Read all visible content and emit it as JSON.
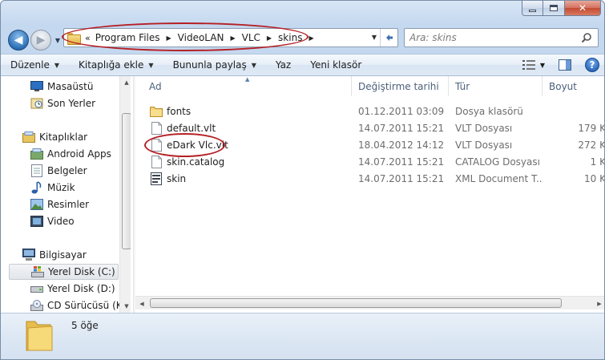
{
  "window": {
    "minimize_icon": "minimize-icon",
    "maximize_icon": "maximize-icon",
    "close_icon": "close-icon"
  },
  "address": {
    "overflow": "«",
    "crumbs": [
      "Program Files",
      "VideoLAN",
      "VLC",
      "skins"
    ]
  },
  "search": {
    "placeholder": "Ara: skins"
  },
  "toolbar": {
    "organize": "Düzenle",
    "include_in_library": "Kitaplığa ekle",
    "share_with": "Bununla paylaş",
    "burn": "Yaz",
    "new_folder": "Yeni klasör"
  },
  "nav": {
    "favorites": [
      {
        "label": "Masaüstü",
        "icon": "desktop-icon"
      },
      {
        "label": "Son Yerler",
        "icon": "recent-places-icon"
      }
    ],
    "libraries_label": "Kitaplıklar",
    "libraries": [
      {
        "label": "Android Apps",
        "icon": "library-icon"
      },
      {
        "label": "Belgeler",
        "icon": "documents-icon"
      },
      {
        "label": "Müzik",
        "icon": "music-icon"
      },
      {
        "label": "Resimler",
        "icon": "pictures-icon"
      },
      {
        "label": "Video",
        "icon": "video-icon"
      }
    ],
    "computer_label": "Bilgisayar",
    "drives": [
      {
        "label": "Yerel Disk (C:)",
        "icon": "windows-drive-icon",
        "selected": true
      },
      {
        "label": "Yerel Disk (D:)",
        "icon": "drive-icon",
        "selected": false
      },
      {
        "label": "CD Sürücüsü (K:)",
        "icon": "cd-drive-icon",
        "selected": false
      }
    ]
  },
  "columns": {
    "name": "Ad",
    "date": "Değiştirme tarihi",
    "type": "Tür",
    "size": "Boyut"
  },
  "files": [
    {
      "name": "fonts",
      "date": "01.12.2011 03:09",
      "type": "Dosya klasörü",
      "size": "",
      "icon": "folder-icon"
    },
    {
      "name": "default.vlt",
      "date": "14.07.2011 15:21",
      "type": "VLT Dosyası",
      "size": "179 K",
      "icon": "file-icon"
    },
    {
      "name": "eDark Vlc.vlt",
      "date": "18.04.2012 14:12",
      "type": "VLT Dosyası",
      "size": "272 K",
      "icon": "file-icon"
    },
    {
      "name": "skin.catalog",
      "date": "14.07.2011 15:21",
      "type": "CATALOG Dosyası",
      "size": "1 K",
      "icon": "file-icon"
    },
    {
      "name": "skin",
      "date": "14.07.2011 15:21",
      "type": "XML Document T...",
      "size": "10 K",
      "icon": "xml-file-icon"
    }
  ],
  "details": {
    "item_count": "5 öğe"
  },
  "colors": {
    "highlight": "#b52024",
    "accent": "#2b6fb5",
    "chrome": "#c4d8ef"
  }
}
